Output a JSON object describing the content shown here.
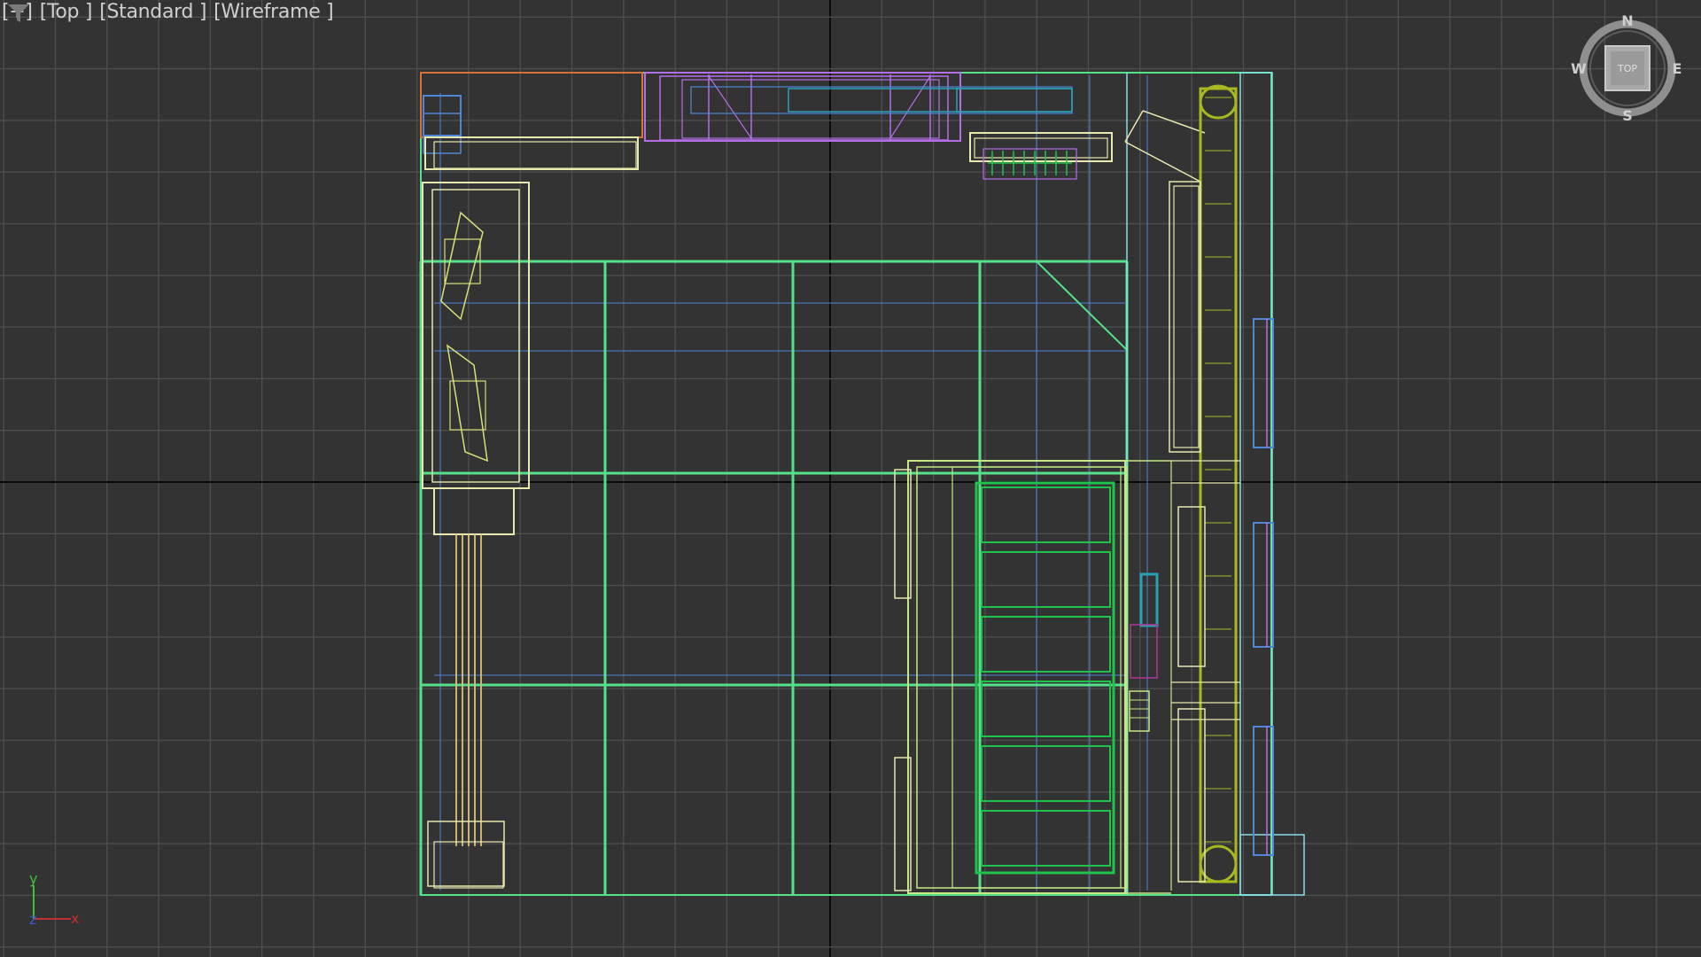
{
  "viewport": {
    "menu_label": "[+]",
    "view_label": "[Top ]",
    "shading_label": "[Standard ]",
    "display_label": "[Wireframe ]",
    "filter_icon": "funnel-icon"
  },
  "viewcube": {
    "face_label": "TOP",
    "north": "N",
    "south": "S",
    "east": "E",
    "west": "W"
  },
  "axis_tripod": {
    "y": "y",
    "x": "x",
    "z": "z"
  },
  "colors": {
    "background": "#333333",
    "grid": "#4d4d4d",
    "grid_axis": "#0a0a0a",
    "green": "#55e08a",
    "bright_green": "#1fc24a",
    "yellow_green": "#c4e886",
    "olive": "#a8b820",
    "yellow": "#d9e07a",
    "light_yellow": "#e8e8b0",
    "tan": "#d9c27a",
    "purple": "#b46ee6",
    "orange": "#d4733a",
    "blue": "#4f86d6",
    "teal": "#2aa0b4",
    "cyan": "#8adbe8",
    "magenta": "#b0369a"
  }
}
